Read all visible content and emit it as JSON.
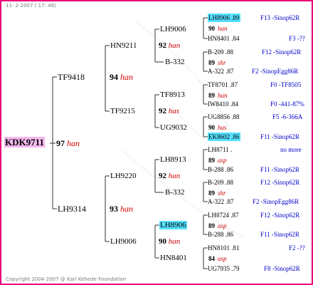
{
  "header": "11- 2-2007 ( 17: 46)",
  "footer": "Copyright 2004-2007 @ Karl Kehede Foundation",
  "colors": {
    "border": "#e8007c",
    "root_highlight": "#f5b8ee",
    "ring_highlight": "#55e0ff",
    "lineage_red": "#cc0000",
    "strain_blue": "#0000cc"
  },
  "root": {
    "ring": "KDK9711",
    "score": "97",
    "lineage": "han"
  },
  "gen1": {
    "sire": {
      "ring": "TF9418",
      "score": "94",
      "lineage": "han"
    },
    "dam": {
      "ring": "LH9314",
      "score": "93",
      "lineage": "han"
    }
  },
  "gen2": [
    {
      "ring": "HN9211",
      "score": "92",
      "lineage": "han"
    },
    {
      "ring": "TF9215",
      "score": "92",
      "lineage": "has"
    },
    {
      "ring": "LH9220",
      "score": "92",
      "lineage": "han"
    },
    {
      "ring": "LH9006",
      "score": "90",
      "lineage": "han"
    }
  ],
  "gen3": [
    "LH9006",
    "B-332",
    "TF8913",
    "UG9032",
    "LH8913",
    "B-332",
    "LH8906",
    "HN8401"
  ],
  "pairs": [
    {
      "score": "90",
      "lineage": "han"
    },
    {
      "score": "89",
      "lineage": "shr"
    },
    {
      "score": "89",
      "lineage": "han"
    },
    {
      "score": "90",
      "lineage": "has"
    },
    {
      "score": "89",
      "lineage": "asp"
    },
    {
      "score": "89",
      "lineage": "shr"
    },
    {
      "score": "89",
      "lineage": "asp"
    },
    {
      "score": "84",
      "lineage": "asp"
    }
  ],
  "gen4": [
    {
      "ring": "LH8906 .89",
      "strain": "F13 -Sinop62R"
    },
    {
      "ring": "HN8401 .84",
      "strain": "F3 -??"
    },
    {
      "ring": "B-209 .88",
      "strain": "F12 -Sinop62R"
    },
    {
      "ring": "A-322 .87",
      "strain": "F2 -SinopEgg86R"
    },
    {
      "ring": "TF8701 .87",
      "strain": "F0 -TF8505"
    },
    {
      "ring": "IW8410 .84",
      "strain": "F0 -441-87%"
    },
    {
      "ring": "UG8856 .88",
      "strain": "F5 -6-366A"
    },
    {
      "ring": "EK8602 .86",
      "strain": "F11 -Sinop62R"
    },
    {
      "ring": "LH8711 .",
      "strain": "no more"
    },
    {
      "ring": "B-288 .86",
      "strain": "F11 -Sinop62R"
    },
    {
      "ring": "B-209 .88",
      "strain": "F12 -Sinop62R"
    },
    {
      "ring": "A-322 .87",
      "strain": "F2 -SinopEgg86R"
    },
    {
      "ring": "LH8724 .87",
      "strain": "F12 -Sinop62R"
    },
    {
      "ring": "B-288 .86",
      "strain": "F11 -Sinop62R"
    },
    {
      "ring": "HN8101 .81",
      "strain": "F2 -??"
    },
    {
      "ring": "UG7935 .79",
      "strain": "F8 -Sinop62R"
    }
  ]
}
